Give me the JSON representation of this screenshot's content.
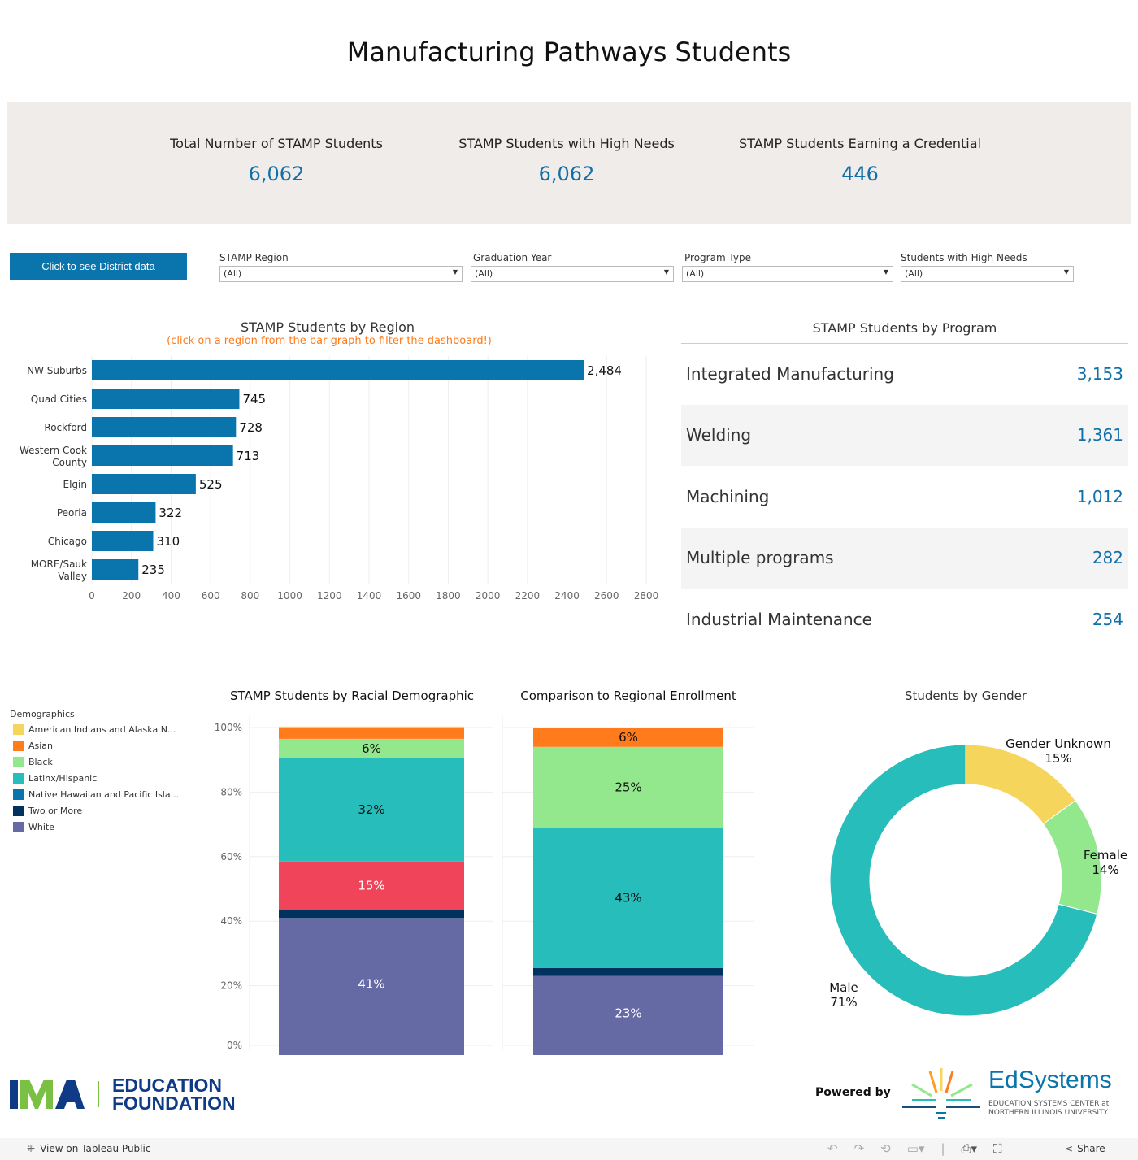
{
  "title": "Manufacturing Pathways Students",
  "kpis": [
    {
      "label": "Total Number of STAMP Students",
      "value": "6,062"
    },
    {
      "label": "STAMP Students with High Needs",
      "value": "6,062"
    },
    {
      "label": "STAMP Students Earning a Credential",
      "value": "446"
    }
  ],
  "district_button": "Click to see District data",
  "filters": [
    {
      "label": "STAMP Region",
      "value": "(All)"
    },
    {
      "label": "Graduation Year",
      "value": "(All)"
    },
    {
      "label": "Program Type",
      "value": "(All)"
    },
    {
      "label": "Students with High Needs",
      "value": "(All)"
    }
  ],
  "programs": {
    "title": "STAMP Students by Program",
    "rows": [
      {
        "name": "Integrated Manufacturing",
        "value": "3,153"
      },
      {
        "name": "Welding",
        "value": "1,361"
      },
      {
        "name": "Machining",
        "value": "1,012"
      },
      {
        "name": "Multiple programs",
        "value": "282"
      },
      {
        "name": "Industrial Maintenance",
        "value": "254"
      }
    ]
  },
  "legend": {
    "title": "Demographics",
    "items": [
      {
        "name": "American Indians and Alaska N...",
        "color": "#f5d55c"
      },
      {
        "name": "Asian",
        "color": "#ff7b1c"
      },
      {
        "name": "Black",
        "color": "#93e88e"
      },
      {
        "name": "Latinx/Hispanic",
        "color": "#27bdbb"
      },
      {
        "name": "Native Hawaiian and Pacific Isla...",
        "color": "#0a75ad"
      },
      {
        "name": "Two or More",
        "color": "#00325f"
      },
      {
        "name": "White",
        "color": "#6569a4"
      }
    ]
  },
  "chart_data": [
    {
      "type": "bar",
      "orientation": "horizontal",
      "title": "STAMP Students by Region",
      "subtitle": "(click on a region from the bar graph to filter the dashboard!)",
      "categories": [
        "NW Suburbs",
        "Quad Cities",
        "Rockford",
        "Western Cook County",
        "Elgin",
        "Peoria",
        "Chicago",
        "MORE/Sauk Valley"
      ],
      "category_labels": [
        [
          "NW Suburbs"
        ],
        [
          "Quad Cities"
        ],
        [
          "Rockford"
        ],
        [
          "Western Cook",
          "County"
        ],
        [
          "Elgin"
        ],
        [
          "Peoria"
        ],
        [
          "Chicago"
        ],
        [
          "MORE/Sauk",
          "Valley"
        ]
      ],
      "values": [
        2484,
        745,
        728,
        713,
        525,
        322,
        310,
        235
      ],
      "data_labels": [
        "2,484",
        "745",
        "728",
        "713",
        "525",
        "322",
        "310",
        "235"
      ],
      "xlim": [
        0,
        2800
      ],
      "xticks": [
        "0",
        "200",
        "400",
        "600",
        "800",
        "1000",
        "1200",
        "1400",
        "1600",
        "1800",
        "2000",
        "2200",
        "2400",
        "2600",
        "2800"
      ],
      "color": "#0a75ad",
      "grid": true
    },
    {
      "type": "bar",
      "stacked": true,
      "title": "STAMP Students by Racial Demographic",
      "ylim": [
        0,
        100
      ],
      "yticks": [
        "0%",
        "20%",
        "40%",
        "60%",
        "80%",
        "100%"
      ],
      "segments": [
        {
          "name": "White",
          "value": 41,
          "label": "41%",
          "color": "#6569a4",
          "text": "#fff"
        },
        {
          "name": "Two or More",
          "value": 2.5,
          "label": "",
          "color": "#00325f",
          "text": "#fff"
        },
        {
          "value": 15,
          "label": "15%",
          "color": "#ef4459",
          "text": "#fff"
        },
        {
          "name": "Latinx/Hispanic",
          "value": 32,
          "label": "32%",
          "color": "#27bdbb",
          "text": "#111"
        },
        {
          "name": "Black",
          "value": 6,
          "label": "6%",
          "color": "#93e88e",
          "text": "#111"
        },
        {
          "name": "Asian",
          "value": 3.5,
          "label": "",
          "color": "#ff7b1c",
          "text": "#111"
        },
        {
          "name": "American Indians and Alaska N...",
          "value": 0.3,
          "label": "",
          "color": "#f5d55c",
          "text": "#111"
        }
      ]
    },
    {
      "type": "bar",
      "stacked": true,
      "title": "Comparison to Regional Enrollment",
      "ylim": [
        0,
        100
      ],
      "segments": [
        {
          "name": "White",
          "value": 23,
          "label": "23%",
          "color": "#6569a4",
          "text": "#fff"
        },
        {
          "name": "Two or More",
          "value": 2.5,
          "label": "",
          "color": "#00325f",
          "text": "#fff"
        },
        {
          "name": "Latinx/Hispanic",
          "value": 43.5,
          "label": "43%",
          "color": "#27bdbb",
          "text": "#111"
        },
        {
          "name": "Black",
          "value": 25,
          "label": "25%",
          "color": "#93e88e",
          "text": "#111"
        },
        {
          "name": "Asian",
          "value": 6,
          "label": "6%",
          "color": "#ff7b1c",
          "text": "#111"
        }
      ]
    },
    {
      "type": "pie",
      "donut": true,
      "title": "Students by Gender",
      "slices": [
        {
          "name": "Gender Unknown",
          "value": 15,
          "label": "15%",
          "color": "#f5d55c"
        },
        {
          "name": "Female",
          "value": 14,
          "label": "14%",
          "color": "#93e88e"
        },
        {
          "name": "Male",
          "value": 71,
          "label": "71%",
          "color": "#27bdbb"
        }
      ]
    }
  ],
  "logos": {
    "ima": "IMA EDUCATION FOUNDATION",
    "powered_by": "Powered by",
    "edsystems": "EdSystems",
    "edsystems_sub": "EDUCATION SYSTEMS CENTER at NORTHERN ILLINOIS UNIVERSITY"
  },
  "footer": {
    "view": "View on Tableau Public",
    "share": "Share"
  }
}
